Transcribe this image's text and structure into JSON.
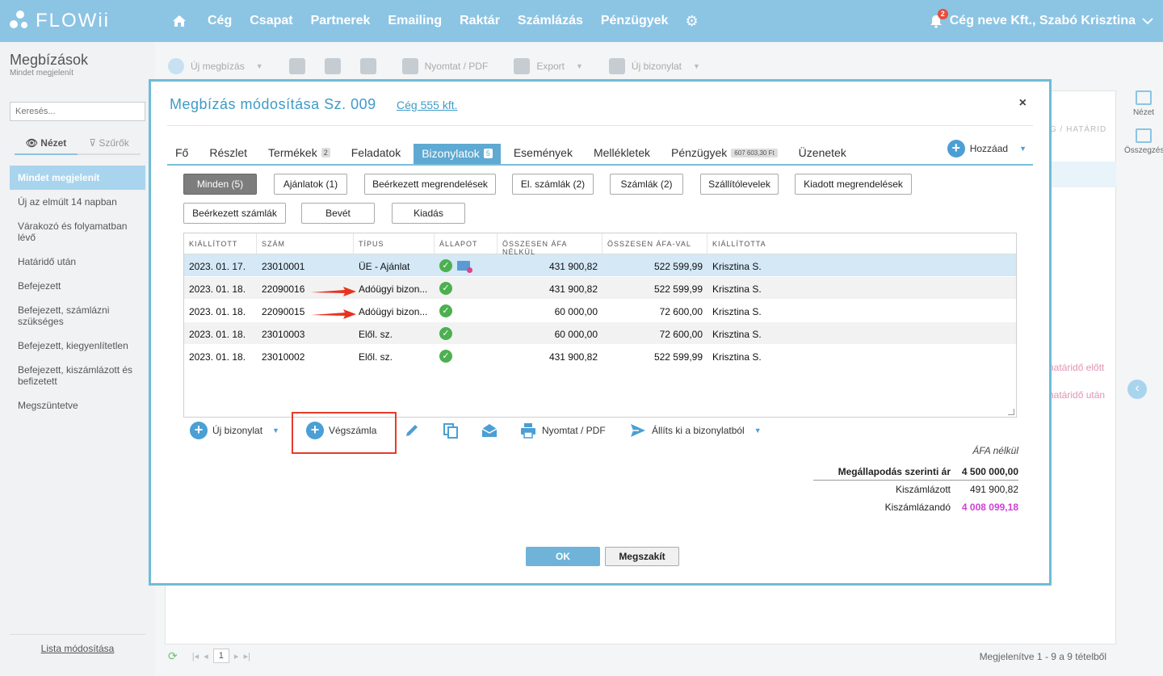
{
  "app": {
    "logo": "FLOWii",
    "nav": [
      "Cég",
      "Csapat",
      "Partnerek",
      "Emailing",
      "Raktár",
      "Számlázás",
      "Pénzügyek"
    ],
    "notification_count": "2",
    "user": "Cég neve Kft., Szabó Krisztina"
  },
  "sidebar": {
    "title": "Megbízások",
    "subtitle": "Mindet megjelenít",
    "search_placeholder": "Keresés...",
    "tab_view": "Nézet",
    "tab_filters": "Szűrők",
    "items": [
      "Mindet megjelenít",
      "Új az elmúlt 14 napban",
      "Várakozó és folyamatban lévő",
      "Határidő után",
      "Befejezett",
      "Befejezett, számlázni szükséges",
      "Befejezett, kiegyenlítetlen",
      "Befejezett, kiszámlázott és befizetett",
      "Megszüntetve"
    ],
    "footer": "Lista módosítása"
  },
  "toolbar": {
    "new": "Új megbízás",
    "print": "Nyomtat / PDF",
    "export": "Export",
    "new_doc": "Új bizonylat"
  },
  "background": {
    "col_header": "G / HATÁRID",
    "late_before": "határidő előtt",
    "late_after": "határidő után",
    "rail_view": "Nézet",
    "rail_summary": "Összegzés",
    "page": "1",
    "page_info": "Megjelenítve 1 - 9 a 9 tételből"
  },
  "modal": {
    "title": "Megbízás módosítása Sz. 009",
    "company": "Cég 555 kft.",
    "close": "×",
    "tabs": [
      {
        "label": "Fő",
        "badge": ""
      },
      {
        "label": "Részlet",
        "badge": ""
      },
      {
        "label": "Termékek",
        "badge": "2"
      },
      {
        "label": "Feladatok",
        "badge": ""
      },
      {
        "label": "Bizonylatok",
        "badge": "5"
      },
      {
        "label": "Események",
        "badge": ""
      },
      {
        "label": "Mellékletek",
        "badge": ""
      },
      {
        "label": "Pénzügyek",
        "badge": "607 603,30 Ft"
      },
      {
        "label": "Üzenetek",
        "badge": ""
      }
    ],
    "add_label": "Hozzáad",
    "filters": [
      "Minden (5)",
      "Ajánlatok (1)",
      "Beérkezett megrendelések",
      "El. számlák (2)",
      "Számlák (2)",
      "Szállítólevelek",
      "Kiadott megrendelések",
      "Beérkezett számlák",
      "Bevét",
      "Kiadás"
    ],
    "table": {
      "headers": [
        "KIÁLLÍTOTT",
        "SZÁM",
        "TÍPUS",
        "ÁLLAPOT",
        "ÖSSZESEN ÁFA NÉLKÜL",
        "ÖSSZESEN ÁFA-VAL",
        "KIÁLLÍTOTTA"
      ],
      "rows": [
        {
          "date": "2023. 01. 17.",
          "num": "23010001",
          "type": "ÜE - Ajánlat",
          "net": "431 900,82",
          "gross": "522 599,99",
          "by": "Krisztina S."
        },
        {
          "date": "2023. 01. 18.",
          "num": "22090016",
          "type": "Adóügyi bizon...",
          "net": "431 900,82",
          "gross": "522 599,99",
          "by": "Krisztina S."
        },
        {
          "date": "2023. 01. 18.",
          "num": "22090015",
          "type": "Adóügyi bizon...",
          "net": "60 000,00",
          "gross": "72 600,00",
          "by": "Krisztina S."
        },
        {
          "date": "2023. 01. 18.",
          "num": "23010003",
          "type": "Elől. sz.",
          "net": "60 000,00",
          "gross": "72 600,00",
          "by": "Krisztina S."
        },
        {
          "date": "2023. 01. 18.",
          "num": "23010002",
          "type": "Elől. sz.",
          "net": "431 900,82",
          "gross": "522 599,99",
          "by": "Krisztina S."
        }
      ]
    },
    "actions": {
      "new_doc": "Új bizonylat",
      "final_invoice": "Végszámla",
      "print": "Nyomtat / PDF",
      "issue_from": "Állíts ki a bizonylatból"
    },
    "sums": {
      "header": "ÁFA nélkül",
      "agreed_label": "Megállapodás szerinti ár",
      "agreed_value": "4 500 000,00",
      "invoiced_label": "Kiszámlázott",
      "invoiced_value": "491 900,82",
      "to_invoice_label": "Kiszámlázandó",
      "to_invoice_value": "4 008 099,18"
    },
    "ok": "OK",
    "cancel": "Megszakít"
  },
  "colors": {
    "topbar": "#8cc4e4",
    "accent": "#4b9fd4",
    "highlight": "#e53c2a",
    "pink": "#d040d8"
  }
}
